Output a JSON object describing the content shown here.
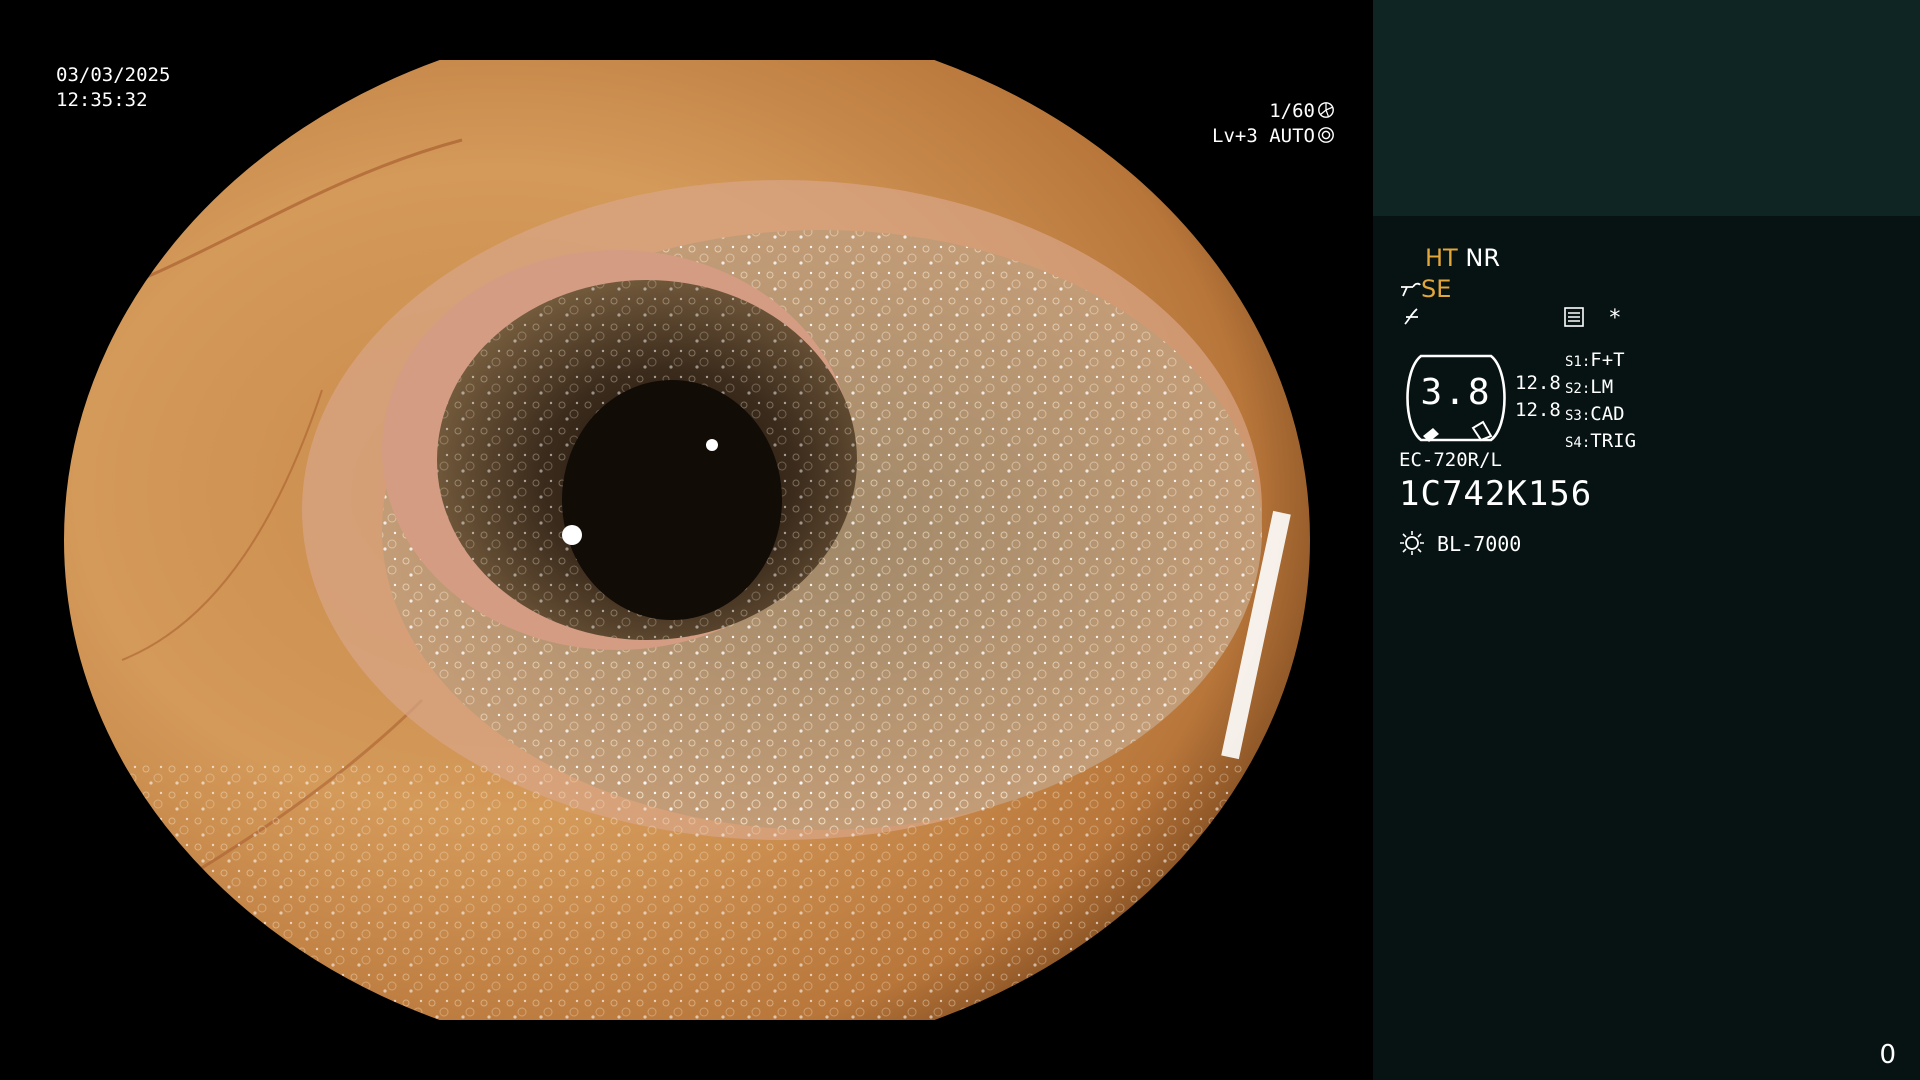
{
  "image": {
    "date": "03/03/2025",
    "time": "12:35:32",
    "shutter": "1/60",
    "level_auto": "Lv+3 AUTO"
  },
  "side": {
    "ht": "HT",
    "nr": "NR",
    "se": "SE",
    "star": "*",
    "gauge_value": "3.8",
    "value_1": "12.8",
    "value_2": "12.8",
    "switches": [
      {
        "label": "S1:",
        "value": "F+T"
      },
      {
        "label": "S2:",
        "value": "LM"
      },
      {
        "label": "S3:",
        "value": "CAD"
      },
      {
        "label": "S4:",
        "value": "TRIG"
      }
    ],
    "scope_model": "EC-720R/L",
    "scope_serial": "1C742K156",
    "light_source": "BL-7000",
    "page_number": "0"
  },
  "colors": {
    "panel_bg": "#061312",
    "patient_bg": "#0e2523",
    "amber": "#e3a63b"
  },
  "icons": [
    "shutter-icon",
    "auto-iris-icon",
    "se-knob-icon",
    "structure-icon",
    "menu-icon",
    "gauge-icon",
    "lamp-icon"
  ]
}
